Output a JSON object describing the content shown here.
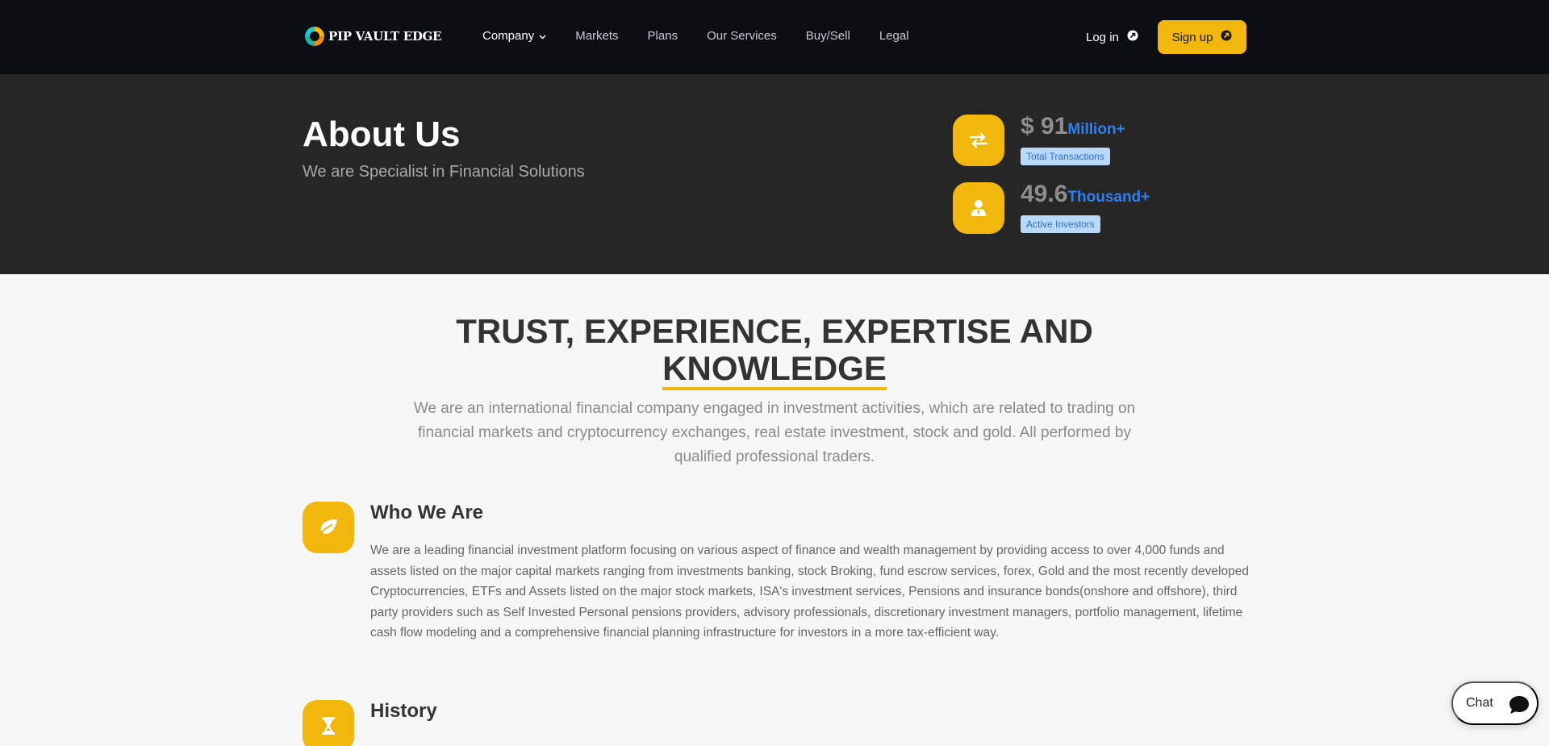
{
  "brand": {
    "name": "PIP VAULT EDGE"
  },
  "nav": {
    "items": [
      {
        "label": "Company",
        "has_dropdown": true,
        "active": true
      },
      {
        "label": "Markets"
      },
      {
        "label": "Plans"
      },
      {
        "label": "Our Services"
      },
      {
        "label": "Buy/Sell"
      },
      {
        "label": "Legal"
      }
    ],
    "login_label": "Log in",
    "signup_label": "Sign up"
  },
  "hero": {
    "title": "About Us",
    "subtitle": "We are Specialist in Financial Solutions",
    "stats": [
      {
        "value": "$ 91",
        "unit": "Million+",
        "label": "Total Transactions",
        "icon": "exchange-icon"
      },
      {
        "value": "49.6",
        "unit": "Thousand+",
        "label": "Active Investors",
        "icon": "investor-icon"
      }
    ]
  },
  "trust": {
    "title_line1": "TRUST, EXPERIENCE, EXPERTISE AND",
    "title_line2": "KNOWLEDGE",
    "text": "We are an international financial company engaged in investment activities, which are related to trading on financial markets and cryptocurrency exchanges, real estate investment, stock and gold. All performed by qualified professional traders."
  },
  "sections": [
    {
      "title": "Who We Are",
      "icon": "leaf-icon",
      "text": "We are a leading financial investment platform focusing on various aspect of finance and wealth management by providing access to over 4,000 funds and assets listed on the major capital markets ranging from investments banking, stock Broking, fund escrow services, forex, Gold and the most recently developed Cryptocurrencies, ETFs and Assets listed on the major stock markets, ISA's investment services, Pensions and insurance bonds(onshore and offshore), third party providers such as Self Invested Personal pensions providers, advisory professionals, discretionary investment managers, portfolio management, lifetime cash flow modeling and a comprehensive financial planning infrastructure for investors in a more tax-efficient way."
    },
    {
      "title": "History",
      "icon": "hourglass-icon"
    }
  ],
  "chat": {
    "label": "Chat"
  },
  "colors": {
    "accent": "#f2b70c",
    "nav_bg": "#0b0e13",
    "hero_bg": "#262626",
    "stat_unit": "#2f80ed",
    "badge_bg": "#b9d9fb"
  }
}
